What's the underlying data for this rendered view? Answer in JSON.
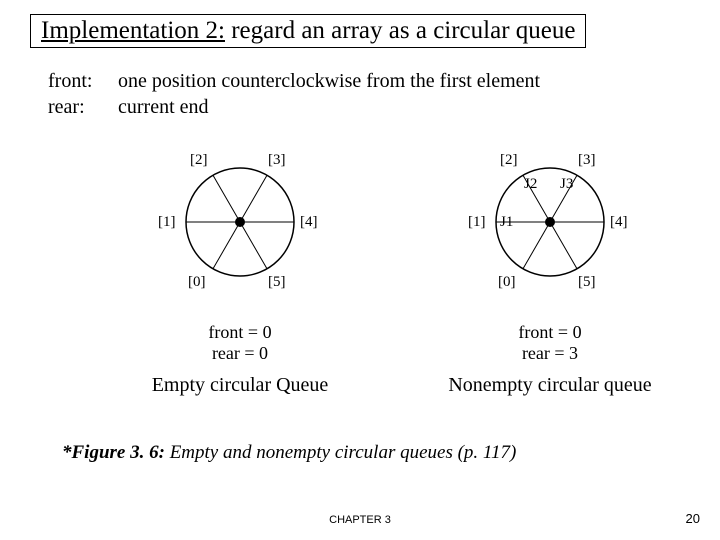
{
  "title": {
    "underlined": "Implementation 2:",
    "rest": " regard an array as a circular queue"
  },
  "defs": {
    "front_label": "front:",
    "front_text": "one position counterclockwise from the first element",
    "rear_label": "rear:",
    "rear_text": "current end"
  },
  "indices": [
    "[0]",
    "[1]",
    "[2]",
    "[3]",
    "[4]",
    "[5]"
  ],
  "left": {
    "front": "front = 0",
    "rear": "rear  = 0",
    "caption": "Empty circular Queue"
  },
  "right": {
    "data": {
      "1": "J1",
      "2": "J2",
      "3": "J3"
    },
    "front": "front = 0",
    "rear": "rear = 3",
    "caption": "Nonempty circular queue"
  },
  "figure": {
    "lead": "*Figure 3. 6:",
    "rest": " Empty and nonempty circular queues (p. 117)"
  },
  "footer": {
    "chapter": "CHAPTER 3",
    "page": "20"
  },
  "chart_data": {
    "type": "table",
    "title": "Circular queues of size 6",
    "series": [
      {
        "name": "Empty circular Queue",
        "front": 0,
        "rear": 0,
        "slots": [
          null,
          null,
          null,
          null,
          null,
          null
        ]
      },
      {
        "name": "Nonempty circular queue",
        "front": 0,
        "rear": 3,
        "slots": [
          null,
          "J1",
          "J2",
          "J3",
          null,
          null
        ]
      }
    ]
  }
}
